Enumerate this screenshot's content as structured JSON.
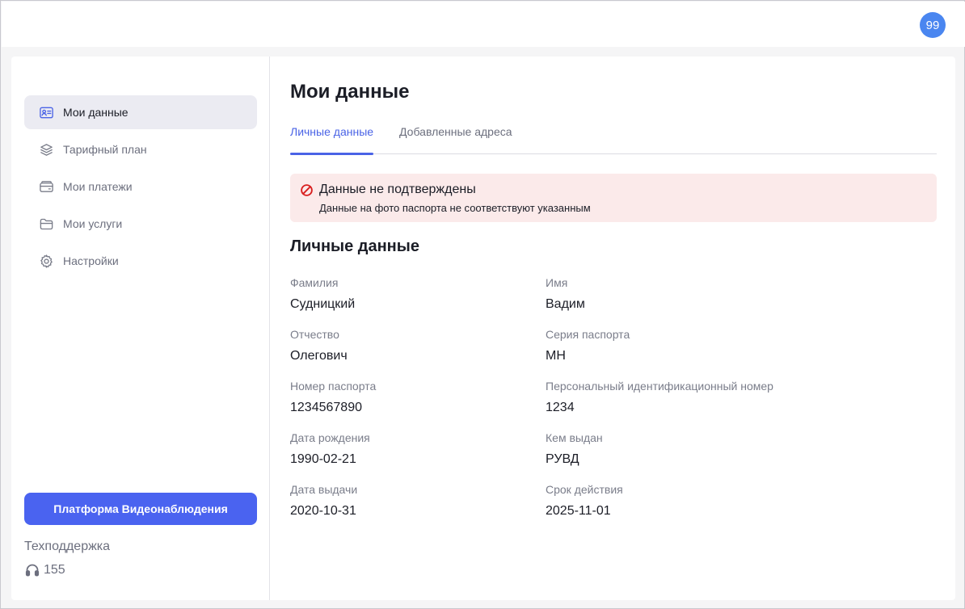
{
  "header": {
    "avatar_text": "99"
  },
  "sidebar": {
    "items": [
      {
        "label": "Мои данные",
        "icon": "id-card-icon",
        "active": true
      },
      {
        "label": "Тарифный план",
        "icon": "layers-icon"
      },
      {
        "label": "Мои платежи",
        "icon": "wallet-icon"
      },
      {
        "label": "Мои услуги",
        "icon": "folder-icon"
      },
      {
        "label": "Настройки",
        "icon": "gear-icon"
      }
    ],
    "promo_button": "Платформа Видеонаблюдения",
    "support_title": "Техподдержка",
    "support_phone": "155"
  },
  "main": {
    "title": "Мои данные",
    "tabs": [
      {
        "label": "Личные данные",
        "active": true
      },
      {
        "label": "Добавленные адреса"
      }
    ],
    "alert": {
      "title": "Данные не подтверждены",
      "text": "Данные на фото паспорта не соответствуют указанным",
      "color": "#d81e1e"
    },
    "section_title": "Личные данные",
    "fields": [
      {
        "label": "Фамилия",
        "value": "Судницкий"
      },
      {
        "label": "Имя",
        "value": "Вадим"
      },
      {
        "label": "Отчество",
        "value": "Олегович"
      },
      {
        "label": "Серия паспорта",
        "value": "МН"
      },
      {
        "label": "Номер паспорта",
        "value": "1234567890"
      },
      {
        "label": "Персональный идентификационный номер",
        "value": "1234"
      },
      {
        "label": "Дата рождения",
        "value": "1990-02-21"
      },
      {
        "label": "Кем выдан",
        "value": "РУВД"
      },
      {
        "label": "Дата выдачи",
        "value": "2020-10-31"
      },
      {
        "label": "Срок действия",
        "value": "2025-11-01"
      }
    ]
  },
  "colors": {
    "accent": "#4a63e6",
    "avatar": "#4a86f0",
    "alert_bg": "#fbeaea"
  }
}
